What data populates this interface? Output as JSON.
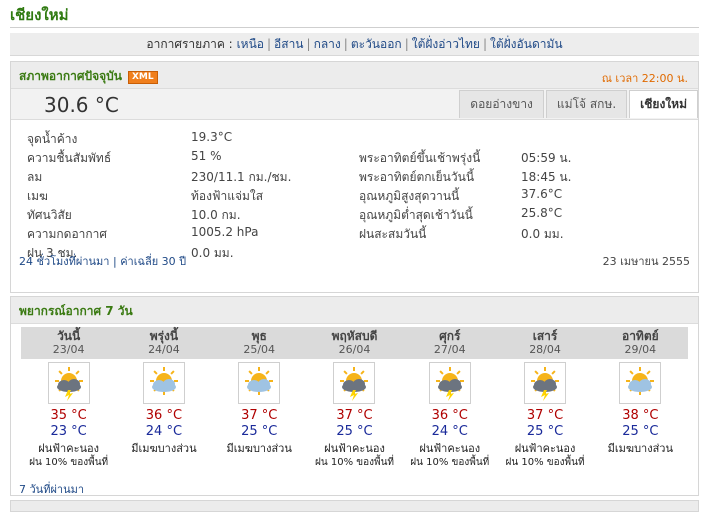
{
  "page": {
    "title": "เชียงใหม่"
  },
  "regions": {
    "label": "อากาศรายภาค :",
    "items": [
      "เหนือ",
      "อีสาน",
      "กลาง",
      "ตะวันออก",
      "ใต้ฝั่งอ่าวไทย",
      "ใต้ฝั่งอันดามัน"
    ]
  },
  "current": {
    "title": "สภาพอากาศปัจจุบัน",
    "xml_badge": "XML",
    "time": "ณ เวลา 22:00 น.",
    "temperature": "30.6 °C",
    "tabs": [
      "ดอยอ่างขาง",
      "แม่โจ้ สกษ.",
      "เชียงใหม่"
    ],
    "active_tab": 2,
    "left": [
      {
        "label": "จุดน้ำค้าง",
        "value": "19.3°C"
      },
      {
        "label": "ความชื้นสัมพัทธ์",
        "value": "51 %"
      },
      {
        "label": "ลม",
        "value": "230/11.1 กม./ชม."
      },
      {
        "label": "เมฆ",
        "value": "ท้องฟ้าแจ่มใส"
      },
      {
        "label": "ทัศนวิสัย",
        "value": "10.0 กม."
      },
      {
        "label": "ความกดอากาศ",
        "value": "1005.2 hPa"
      },
      {
        "label": "ฝน 3 ชม.",
        "value": "0.0 มม."
      }
    ],
    "right": [
      {
        "label": "พระอาทิตย์ขึ้นเช้าพรุ่งนี้",
        "value": "05:59 น."
      },
      {
        "label": "พระอาทิตย์ตกเย็นวันนี้",
        "value": "18:45 น."
      },
      {
        "label": "อุณหภูมิสูงสุดวานนี้",
        "value": "37.6°C"
      },
      {
        "label": "อุณหภูมิต่ำสุดเช้าวันนี้",
        "value": "25.8°C"
      },
      {
        "label": "ฝนสะสมวันนี้",
        "value": "0.0 มม."
      }
    ],
    "link_24h": "24 ชั่วโมงที่ผ่านมา",
    "link_avg": "ค่าเฉลี่ย 30 ปี",
    "date": "23 เมษายน 2555"
  },
  "forecast": {
    "title": "พยากรณ์อากาศ 7 วัน",
    "past_link": "7 วันที่ผ่านมา",
    "days": [
      {
        "name": "วันนี้",
        "date": "23/04",
        "hi": "35 °C",
        "lo": "23 °C",
        "desc": "ฝนฟ้าคะนอง",
        "rain": "ฝน 10% ของพื้นที่",
        "icon": "storm-icon"
      },
      {
        "name": "พรุ่งนี้",
        "date": "24/04",
        "hi": "36 °C",
        "lo": "24 °C",
        "desc": "มีเมฆบางส่วน",
        "rain": "",
        "icon": "partly-cloudy-icon"
      },
      {
        "name": "พุธ",
        "date": "25/04",
        "hi": "37 °C",
        "lo": "25 °C",
        "desc": "มีเมฆบางส่วน",
        "rain": "",
        "icon": "partly-cloudy-icon"
      },
      {
        "name": "พฤหัสบดี",
        "date": "26/04",
        "hi": "37 °C",
        "lo": "25 °C",
        "desc": "ฝนฟ้าคะนอง",
        "rain": "ฝน 10% ของพื้นที่",
        "icon": "storm-icon"
      },
      {
        "name": "ศุกร์",
        "date": "27/04",
        "hi": "36 °C",
        "lo": "24 °C",
        "desc": "ฝนฟ้าคะนอง",
        "rain": "ฝน 10% ของพื้นที่",
        "icon": "storm-icon"
      },
      {
        "name": "เสาร์",
        "date": "28/04",
        "hi": "37 °C",
        "lo": "25 °C",
        "desc": "ฝนฟ้าคะนอง",
        "rain": "ฝน 10% ของพื้นที่",
        "icon": "storm-icon"
      },
      {
        "name": "อาทิตย์",
        "date": "29/04",
        "hi": "38 °C",
        "lo": "25 °C",
        "desc": "มีเมฆบางส่วน",
        "rain": "",
        "icon": "partly-cloudy-icon"
      }
    ]
  },
  "colors": {
    "green_title": "#3a7a12",
    "orange": "#f07f1d",
    "high_temp": "#b00000",
    "low_temp": "#1a2a9a",
    "link": "#204a87"
  }
}
